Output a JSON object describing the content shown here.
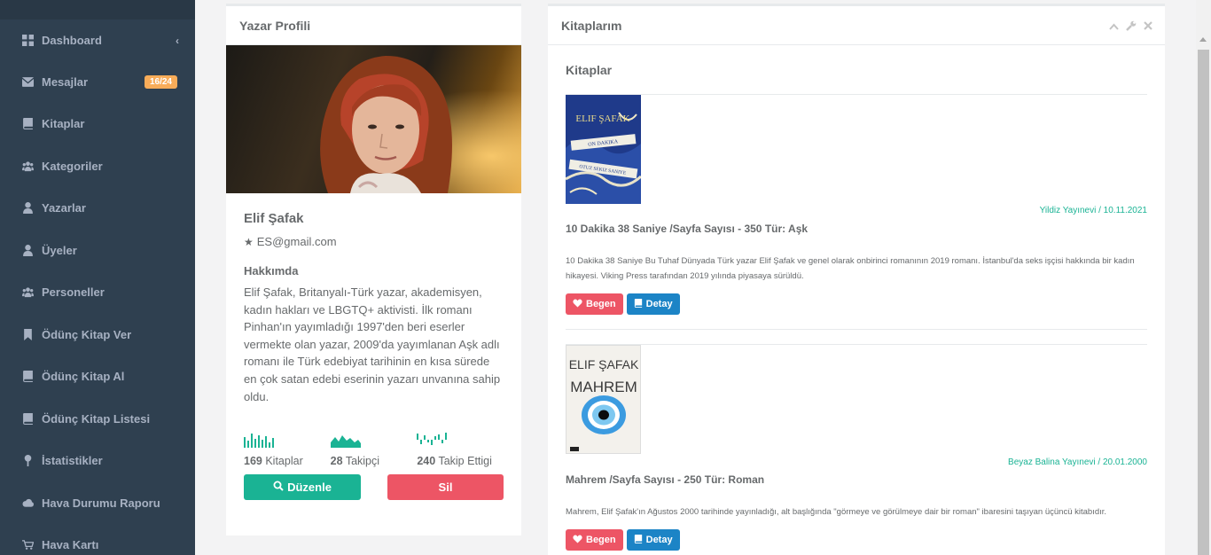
{
  "sidebar": {
    "items": [
      {
        "label": "Dashboard",
        "icon": "th-large-icon",
        "chevron": "‹"
      },
      {
        "label": "Mesajlar",
        "icon": "envelope-icon",
        "badge": "16/24"
      },
      {
        "label": "Kitaplar",
        "icon": "book-icon"
      },
      {
        "label": "Kategoriler",
        "icon": "users-icon"
      },
      {
        "label": "Yazarlar",
        "icon": "user-icon"
      },
      {
        "label": "Üyeler",
        "icon": "user-icon"
      },
      {
        "label": "Personeller",
        "icon": "users-icon"
      },
      {
        "label": "Ödünç Kitap Ver",
        "icon": "bookmark-icon"
      },
      {
        "label": "Ödünç Kitap Al",
        "icon": "book-icon"
      },
      {
        "label": "Ödünç Kitap Listesi",
        "icon": "book-icon"
      },
      {
        "label": "İstatistikler",
        "icon": "map-marker-icon"
      },
      {
        "label": "Hava Durumu Raporu",
        "icon": "cloud-icon"
      },
      {
        "label": "Hava Kartı",
        "icon": "cart-icon"
      }
    ]
  },
  "profile": {
    "panel_title": "Yazar Profili",
    "name": "Elif Şafak",
    "email": "ES@gmail.com",
    "about_title": "Hakkımda",
    "about_text": "Elif Şafak, Britanyalı-Türk yazar, akademisyen, kadın hakları ve LBGTQ+ aktivisti. İlk romanı Pinhan'ın yayımladığı 1997'den beri eserler vermekte olan yazar, 2009'da yayımlanan Aşk adlı romanı ile Türk edebiyat tarihinin en kısa sürede en çok satan edebi eserinin yazarı unvanına sahip oldu.",
    "stats": [
      {
        "value": "169",
        "label": "Kitaplar"
      },
      {
        "value": "28",
        "label": "Takipçi"
      },
      {
        "value": "240",
        "label": "Takip Ettigi"
      }
    ],
    "edit_label": "Düzenle",
    "delete_label": "Sil"
  },
  "books_panel": {
    "title": "Kitaplarım",
    "heading": "Kitaplar",
    "books": [
      {
        "meta": "Yildiz Yayınevi / 10.11.2021",
        "title": "10 Dakika 38 Saniye /Sayfa Sayısı - 350 Tür: Aşk",
        "desc": "10 Dakika 38 Saniye Bu Tuhaf Dünyada Türk yazar Elif Şafak ve genel olarak onbirinci romanının 2019 romanı. İstanbul'da seks işçisi hakkında bir kadın hikayesi. Viking Press tarafından 2019 yılında piyasaya sürüldü.",
        "cover_author": "ELIF ŞAFAK",
        "cover_line1": "ON DAKIKA",
        "cover_line2": "OTUZ SEKIZ SANIYE",
        "like_label": "Begen",
        "detail_label": "Detay"
      },
      {
        "meta": "Beyaz Balina Yayınevi / 20.01.2000",
        "title": "Mahrem /Sayfa Sayısı - 250 Tür: Roman",
        "desc": "Mahrem, Elif Şafak'ın Ağustos 2000 tarihinde yayınladığı, alt başlığında \"görmeye ve görülmeye dair bir roman\" ibaresini taşıyan üçüncü kitabıdır.",
        "cover_author": "ELIF ŞAFAK",
        "cover_title": "MAHREM",
        "like_label": "Begen",
        "detail_label": "Detay"
      }
    ]
  },
  "colors": {
    "sidebar": "#2f4050",
    "primary": "#1ab394",
    "danger": "#ed5565",
    "info": "#1c84c6",
    "badge": "#f8ac59"
  }
}
